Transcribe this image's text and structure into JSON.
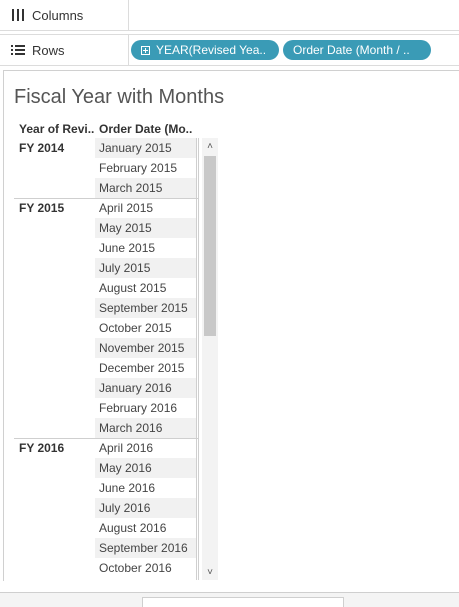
{
  "shelves": {
    "columns_label": "Columns",
    "rows_label": "Rows",
    "row_pills": [
      "YEAR(Revised Yea..",
      "Order Date (Month / .."
    ]
  },
  "view": {
    "title": "Fiscal Year with Months",
    "headers": [
      "Year of Revi..",
      "Order Date (Mo.."
    ]
  },
  "table": {
    "groups": [
      {
        "year": "FY 2014",
        "months": [
          "January 2015",
          "February 2015",
          "March 2015"
        ]
      },
      {
        "year": "FY 2015",
        "months": [
          "April 2015",
          "May 2015",
          "June 2015",
          "July 2015",
          "August 2015",
          "September 2015",
          "October 2015",
          "November 2015",
          "December 2015",
          "January 2016",
          "February 2016",
          "March 2016"
        ]
      },
      {
        "year": "FY 2016",
        "months": [
          "April 2016",
          "May 2016",
          "June 2016",
          "July 2016",
          "August 2016",
          "September 2016",
          "October 2016"
        ]
      }
    ]
  },
  "colors": {
    "pill": "#3a9bb6",
    "band": "#f1f1f1"
  }
}
